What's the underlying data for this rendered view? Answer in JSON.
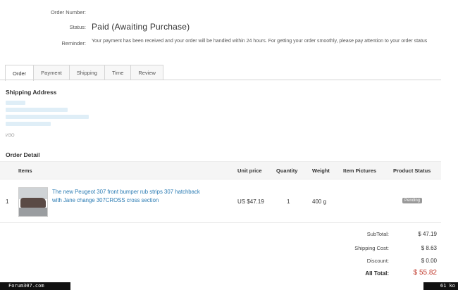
{
  "order": {
    "number_label": "Order Number:",
    "number_value": "",
    "status_label": "Status:",
    "status_value": "Paid (Awaiting Purchase)",
    "reminder_label": "Reminder:",
    "reminder_value": "Your payment has been received and your order will be handled within 24 hours. For getting your order smoothly, please pay attention to your order status"
  },
  "tabs": [
    "Order",
    "Payment",
    "Shipping",
    "Time",
    "Review"
  ],
  "active_tab": "Order",
  "shipping": {
    "title": "Shipping Address",
    "small_text": "ИЗО"
  },
  "order_detail": {
    "title": "Order Detail",
    "columns": [
      "Items",
      "Unit price",
      "Quantity",
      "Weight",
      "Item Pictures",
      "Product Status"
    ],
    "rows": [
      {
        "index": "1",
        "item": "The new Peugeot 307 front bumper rub strips 307 hatchback with Jane change 307CROSS cross section",
        "unit_price": "US $47.19",
        "quantity": "1",
        "weight": "400 g",
        "status": "Pending"
      }
    ]
  },
  "summary": {
    "subtotal_label": "SubTotal:",
    "subtotal_value": "$ 47.19",
    "shipping_label": "Shipping Cost:",
    "shipping_value": "$ 8.63",
    "discount_label": "Discount:",
    "discount_value": "$ 0.00",
    "total_label": "All Total:",
    "total_value": "$ 55.82"
  },
  "footer": {
    "left": "Forum307.com",
    "right": "61 ko"
  },
  "colors": {
    "link": "#2a7bb3",
    "total": "#c0392b",
    "status_badge": "#999999"
  }
}
